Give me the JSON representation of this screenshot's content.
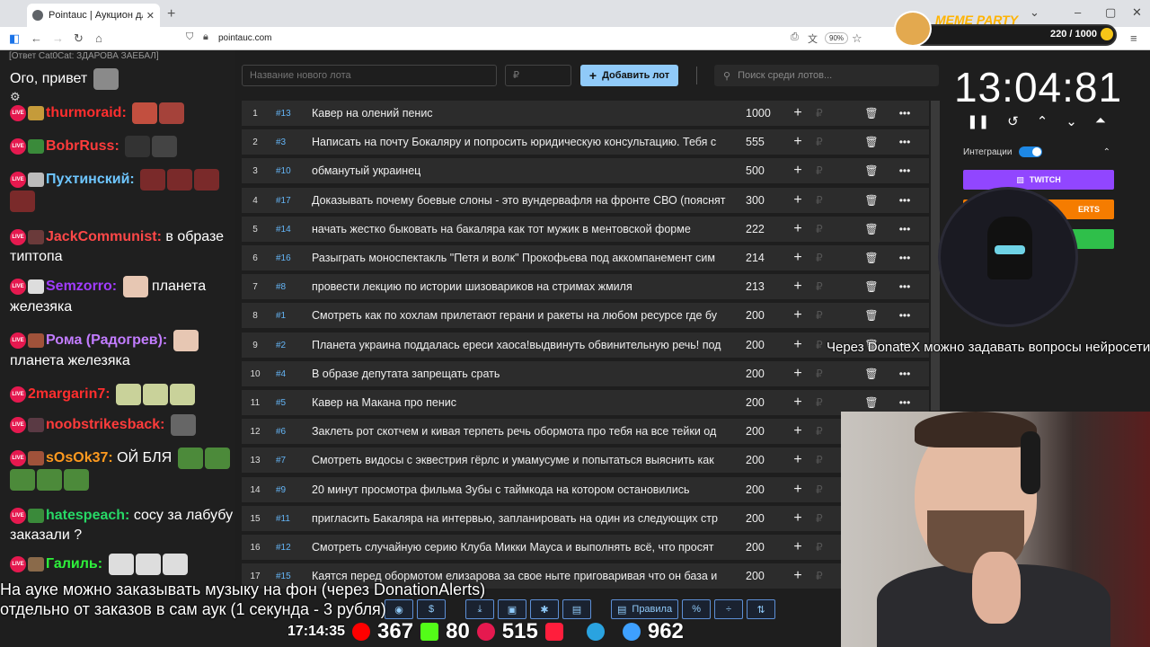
{
  "browser": {
    "tab_title": "Pointauc | Аукцион для стримера",
    "url": "pointauc.com",
    "zoom": "90%"
  },
  "meme_party": {
    "title": "MEME PARTY",
    "count": "220 / 1000"
  },
  "chat": {
    "reply": "[Ответ Cat0Cat: ЗДАРОВА ЗАЕБАЛ]",
    "first_line": "Ого, привет",
    "messages": [
      {
        "nick": "thurmoraid:",
        "color": "#ff2e2e",
        "text": ""
      },
      {
        "nick": "BobrRuss:",
        "color": "#ff3b3b",
        "text": ""
      },
      {
        "nick": "Пухтинский:",
        "color": "#6ec6ff",
        "text": ""
      },
      {
        "nick": "JackCommunist:",
        "color": "#ff4848",
        "text": "в образе типтопа"
      },
      {
        "nick": "Semzorro:",
        "color": "#a13cff",
        "text": "планета железяка"
      },
      {
        "nick": "Рома (Радогрев):",
        "color": "#c27cff",
        "text": "планета железяка"
      },
      {
        "nick": "2margarin7:",
        "color": "#ff2e2e",
        "text": ""
      },
      {
        "nick": "noobstrikesback:",
        "color": "#ff3b3b",
        "text": ""
      },
      {
        "nick": "sOsOk37:",
        "color": "#ff9a1f",
        "text": "ОЙ БЛЯ"
      },
      {
        "nick": "hatespeach:",
        "color": "#27d866",
        "text": "сосу за лабубу заказали ?"
      },
      {
        "nick": "Галиль:",
        "color": "#2ef23b",
        "text": ""
      }
    ]
  },
  "auction": {
    "new_lot_placeholder": "Название нового лота",
    "price_placeholder": "₽",
    "add_button": "Добавить лот",
    "search_placeholder": "Поиск среди лотов...",
    "lots": [
      {
        "n": "1",
        "id": "#13",
        "name": "Кавер на олений пенис",
        "amount": "1000"
      },
      {
        "n": "2",
        "id": "#3",
        "name": "Написать на почту Бокаляру и попросить юридическую консультацию. Тебя с",
        "amount": "555"
      },
      {
        "n": "3",
        "id": "#10",
        "name": "обманутый украинец",
        "amount": "500"
      },
      {
        "n": "4",
        "id": "#17",
        "name": "Доказывать почему боевые слоны - это вундервафля на фронте СВО (пояснят",
        "amount": "300"
      },
      {
        "n": "5",
        "id": "#14",
        "name": "начать жестко быковать на бакаляра как тот мужик в ментовской форме",
        "amount": "222"
      },
      {
        "n": "6",
        "id": "#16",
        "name": "Разыграть моноспектакль \"Петя и волк\" Прокофьева под аккомпанемент сим",
        "amount": "214"
      },
      {
        "n": "7",
        "id": "#8",
        "name": "провести лекцию по истории шизовариков на стримах жмиля",
        "amount": "213"
      },
      {
        "n": "8",
        "id": "#1",
        "name": "Смотреть как по хохлам прилетают герани и ракеты на любом ресурсе где бу",
        "amount": "200"
      },
      {
        "n": "9",
        "id": "#2",
        "name": "Планета украина поддалась ереси хаоса!выдвинуть обвинительную речь! под",
        "amount": "200"
      },
      {
        "n": "10",
        "id": "#4",
        "name": "В образе депутата запрещать срать",
        "amount": "200"
      },
      {
        "n": "11",
        "id": "#5",
        "name": "Кавер на Макана про пенис",
        "amount": "200"
      },
      {
        "n": "12",
        "id": "#6",
        "name": "Заклеть рот скотчем и кивая терпеть речь обормота про тебя на все тейки од",
        "amount": "200"
      },
      {
        "n": "13",
        "id": "#7",
        "name": "Смотреть видосы с эквестрия гёрлс и умамусуме и попытаться выяснить как",
        "amount": "200"
      },
      {
        "n": "14",
        "id": "#9",
        "name": "20 минут просмотра фильма Зубы с таймкода на котором остановились",
        "amount": "200"
      },
      {
        "n": "15",
        "id": "#11",
        "name": "пригласить Бакаляра на интервью, запланировать на один из следующих стр",
        "amount": "200"
      },
      {
        "n": "16",
        "id": "#12",
        "name": "Смотреть случайную серию Клуба Микки Мауса и выполнять всё, что просят",
        "amount": "200"
      },
      {
        "n": "17",
        "id": "#15",
        "name": "Каятся перед обормотом елизарова за свое ныте приговаривая что он база и",
        "amount": "200"
      }
    ],
    "toolbar_rules": "Правила"
  },
  "timer": {
    "value": "13:04:81"
  },
  "integrations": {
    "label": "Интеграции",
    "twitch": "TWITCH",
    "alerts": "ERTS"
  },
  "overlay": {
    "caption1": "На ауке можно заказывать музыку на фон (через DonationAlerts)",
    "caption2": "отдельно от заказов в сам аук (1 секунда - 3 рубля)",
    "donatex": "Через DonateX можно задавать вопросы нейросети",
    "clock": "17:14:35",
    "youtube": "367",
    "kick": "80",
    "vk": "515",
    "viewers": "962"
  }
}
